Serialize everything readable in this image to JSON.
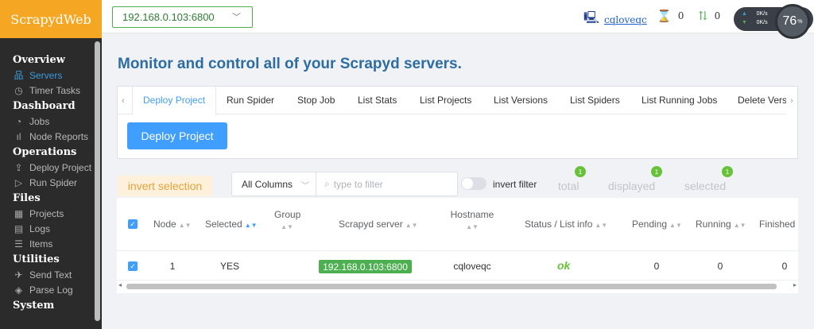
{
  "app": {
    "name": "ScrapydWeb"
  },
  "sidebar": {
    "sections": [
      {
        "title": "Overview",
        "items": [
          {
            "label": "Servers",
            "icon": "sitemap-icon",
            "active": true
          },
          {
            "label": "Timer Tasks",
            "icon": "clock-icon"
          }
        ]
      },
      {
        "title": "Dashboard",
        "items": [
          {
            "label": "Jobs",
            "icon": "gauge-icon"
          },
          {
            "label": "Node Reports",
            "icon": "bars-icon"
          }
        ]
      },
      {
        "title": "Operations",
        "items": [
          {
            "label": "Deploy Project",
            "icon": "upload-icon"
          },
          {
            "label": "Run Spider",
            "icon": "play-icon"
          }
        ]
      },
      {
        "title": "Files",
        "items": [
          {
            "label": "Projects",
            "icon": "grid-icon"
          },
          {
            "label": "Logs",
            "icon": "doc-icon"
          },
          {
            "label": "Items",
            "icon": "list-icon"
          }
        ]
      },
      {
        "title": "Utilities",
        "items": [
          {
            "label": "Send Text",
            "icon": "send-icon"
          },
          {
            "label": "Parse Log",
            "icon": "compass-icon"
          }
        ]
      },
      {
        "title": "System",
        "items": []
      }
    ]
  },
  "header": {
    "node_value": "192.168.0.103:6800",
    "user": "cqloveqc",
    "pending_count": "0",
    "transfer_count": "0",
    "net_up": "0K/s",
    "net_down": "0K/s",
    "gauge_value": "76",
    "gauge_unit": "%"
  },
  "main": {
    "title": "Monitor and control all of your Scrapyd servers.",
    "tabs": [
      "Deploy Project",
      "Run Spider",
      "Stop Job",
      "List Stats",
      "List Projects",
      "List Versions",
      "List Spiders",
      "List Running Jobs",
      "Delete Versi"
    ],
    "deploy_button": "Deploy Project"
  },
  "filter_bar": {
    "invert_selection": "invert selection",
    "column_select": "All Columns",
    "filter_placeholder": "type to filter",
    "invert_filter": "invert filter",
    "total_label": "total",
    "total_count": "1",
    "displayed_label": "displayed",
    "displayed_count": "1",
    "selected_label": "selected",
    "selected_count": "1"
  },
  "table": {
    "headers": [
      "Node",
      "Selected",
      "Group",
      "Scrapyd server",
      "Hostname",
      "Status / List info",
      "Pending",
      "Running",
      "Finished"
    ],
    "rows": [
      {
        "node": "1",
        "selected": "YES",
        "group": "",
        "server": "192.168.0.103:6800",
        "hostname": "cqloveqc",
        "status": "ok",
        "pending": "0",
        "running": "0",
        "finished": "0"
      }
    ]
  }
}
